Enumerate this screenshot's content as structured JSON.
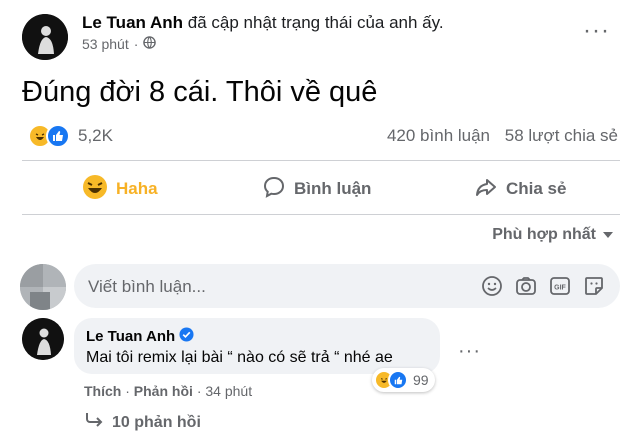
{
  "post": {
    "author": "Le Tuan Anh",
    "action": "đã cập nhật trạng thái của anh ấy.",
    "time": "53 phút",
    "separator": "·",
    "privacy_icon": "globe-icon",
    "text": "Đúng đời 8 cái. Thôi về quê",
    "reaction_count": "5,2K",
    "comments": "420 bình luận",
    "shares": "58 lượt chia sẻ"
  },
  "actions": {
    "haha_label": "Haha",
    "comment_label": "Bình luận",
    "share_label": "Chia sẻ"
  },
  "sort": {
    "label": "Phù hợp nhất"
  },
  "composer": {
    "placeholder": "Viết bình luận..."
  },
  "comment": {
    "author": "Le Tuan Anh",
    "text": "Mai tôi remix lại bài “ nào có sẽ trả “ nhé ae",
    "reaction_count": "99",
    "like_label": "Thích",
    "reply_label": "Phản hồi",
    "time": "34 phút",
    "replies_label": "10 phản hồi"
  },
  "colors": {
    "haha": "#f7b928",
    "like": "#1877f2",
    "secondary_text": "#65676b"
  }
}
